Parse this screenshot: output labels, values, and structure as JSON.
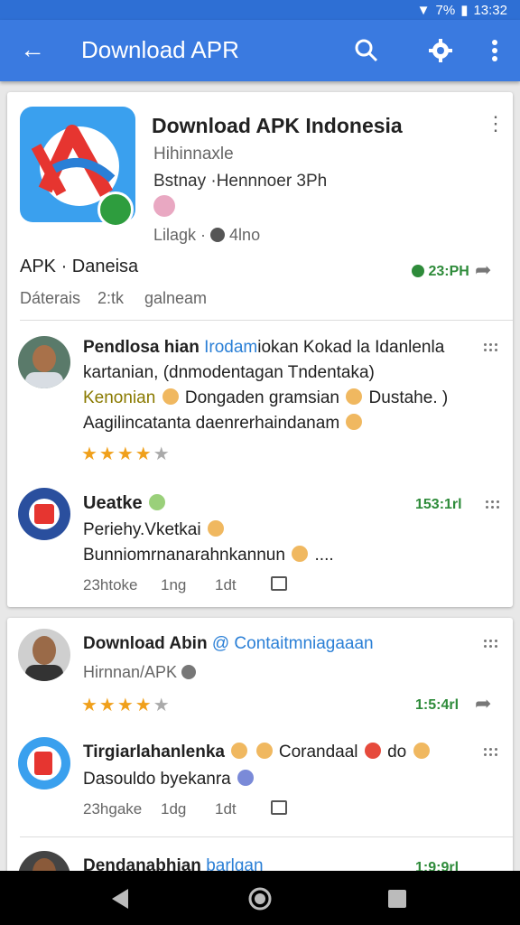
{
  "status": {
    "battery": "7%",
    "time": "13:32"
  },
  "appbar": {
    "title": "Download APR"
  },
  "featured": {
    "title": "Download APK Indonesia",
    "subtitle": "Hihinnaxle",
    "line2": "Bstnay ·Hennnoer 3Ph",
    "meta": "Lilagk · ",
    "meta_count": "4lno",
    "name": "APK · Daneisa",
    "time": "23:PH",
    "tabs": [
      "Dáterais",
      "2:tk",
      "galneam"
    ]
  },
  "post1": {
    "title": "Pendlosa hian",
    "title_link": "Irodam",
    "title_rest": "iokan Kokad la Idanlenla",
    "line2": "kartanian, (dnmodentagan Tndentaka)",
    "line3_highlight": "Kenonian",
    "line3_rest": "Dongaden gramsian",
    "line3_end": "Dustahe. )",
    "line4": "Aagilincatanta daenrerhaindanam",
    "rating": 4
  },
  "post2": {
    "title": "Ueatke",
    "time": "153:1rl",
    "line2": "Periehy.Vketkai",
    "line3": "Bunniomrnanarahnkannun",
    "line3_end": "....",
    "stats": [
      "23htoke",
      "1ng",
      "1dt"
    ]
  },
  "post3": {
    "title": "Download Abin",
    "title_link": "@ Contaitmniagaaan",
    "subtitle": "Hirnnan/APK",
    "time": "1:5:4rl",
    "rating": 4
  },
  "post4": {
    "title": "Tirgiarlahanlenka",
    "title_rest": "Corandaal",
    "title_end": "do",
    "line2": "Dasouldo byekanra",
    "stats": [
      "23hgake",
      "1dg",
      "1dt"
    ]
  },
  "post5": {
    "title": "Dendanabhian",
    "title_link": "barlgan",
    "time": "1:9:9rl"
  },
  "colors": {
    "appbar": "#3a7ae0",
    "accent_green": "#2e8b3a",
    "star": "#f0a01b",
    "link": "#2a7fd6"
  }
}
